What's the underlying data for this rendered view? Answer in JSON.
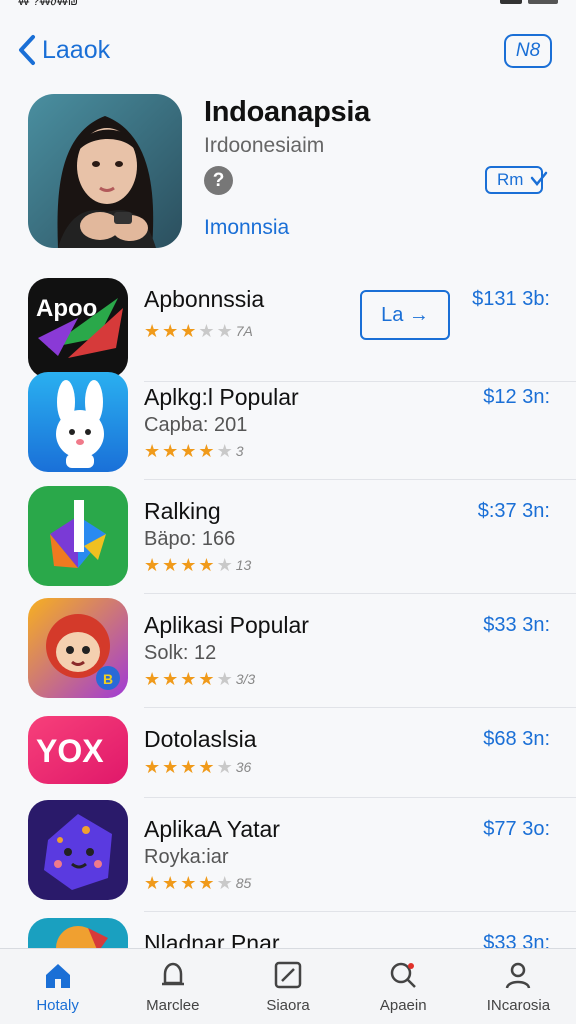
{
  "status_bar": {
    "left": "₩ ?₩∂₩₪",
    "right": ""
  },
  "nav": {
    "back_label": "Laaok",
    "badge_label": "N8"
  },
  "hero": {
    "title": "Indoanapsia",
    "subtitle": "Irdoonesiaim",
    "help_glyph": "?",
    "link": "Imonnsia",
    "button_label": "Rm"
  },
  "apps": [
    {
      "name": "Apbonnssia",
      "meta": "",
      "rating": 3,
      "count": "7A",
      "price": "$131 3b:",
      "button": "La →",
      "icon": "apoc-logo-icon"
    },
    {
      "name": "Aplkg:l Popular",
      "meta": "Capba: 201",
      "rating": 4,
      "count": "3",
      "price": "$12 3n:",
      "icon": "bunny-icon"
    },
    {
      "name": "Ralking",
      "meta": "Bäpo: 166",
      "rating": 4,
      "count": "13",
      "price": "$:37 3n:",
      "icon": "colorful-d-icon"
    },
    {
      "name": "Aplikasi Popular",
      "meta": "Solk: 12",
      "rating": 4,
      "count": "3/3",
      "price": "$33 3n:",
      "icon": "cartoon-character-icon"
    },
    {
      "name": "Dotolaslsia",
      "meta": "",
      "rating": 4,
      "count": "36",
      "price": "$68 3n:",
      "icon": "yox-logo-icon"
    },
    {
      "name": "AplikaA Yatar",
      "meta": "Royka:iar",
      "rating": 4,
      "count": "85",
      "price": "$77 3o:",
      "icon": "purple-monster-icon"
    },
    {
      "name": "Nladnar Pnar",
      "meta": "",
      "rating": 0,
      "count": "",
      "price": "$33 3n:",
      "icon": "partial-app-icon"
    }
  ],
  "tabs": [
    {
      "label": "Hotaly",
      "icon": "home-icon",
      "active": true
    },
    {
      "label": "Marclee",
      "icon": "bell-icon",
      "active": false
    },
    {
      "label": "Siaora",
      "icon": "edit-icon",
      "active": false
    },
    {
      "label": "Apaein",
      "icon": "search-icon",
      "active": false
    },
    {
      "label": "INcarosia",
      "icon": "profile-icon",
      "active": false
    }
  ],
  "colors": {
    "accent": "#1a6fd6",
    "star": "#f09a1a",
    "background": "#f7f8fa"
  }
}
